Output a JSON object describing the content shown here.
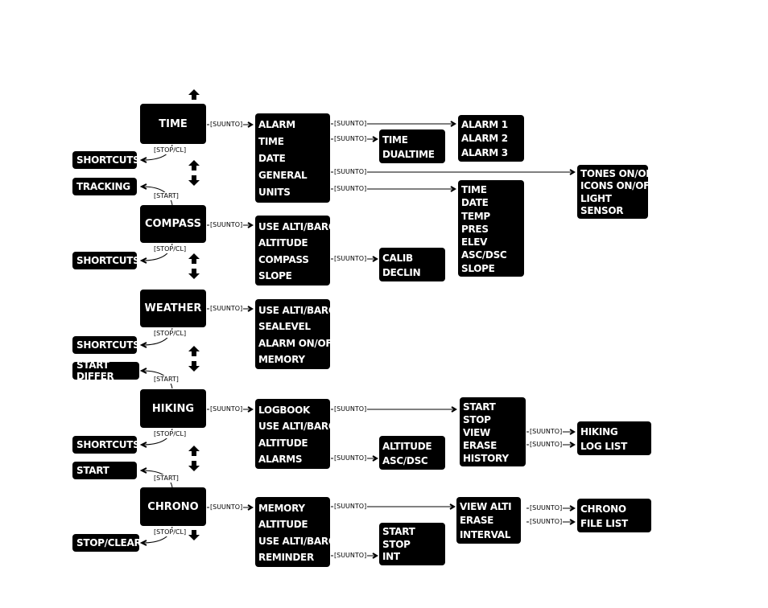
{
  "connector_labels": {
    "suunto": "[SUUNTO]",
    "stop_cl": "[STOP/CL]",
    "start": "[START]"
  },
  "modes": [
    "TIME",
    "COMPASS",
    "WEATHER",
    "HIKING",
    "CHRONO"
  ],
  "left_actions": [
    "SHORTCUTS",
    "TRACKING",
    "SHORTCUTS",
    "SHORTCUTS",
    "START DIFFER",
    "SHORTCUTS",
    "START",
    "STOP/CLEAR"
  ],
  "menus": {
    "time": [
      "ALARM",
      "TIME",
      "DATE",
      "GENERAL",
      "UNITS"
    ],
    "compass": [
      "USE ALTI/BARO",
      "ALTITUDE",
      "COMPASS",
      "SLOPE"
    ],
    "weather": [
      "USE ALTI/BARO",
      "SEALEVEL",
      "ALARM ON/OFF",
      "MEMORY"
    ],
    "hiking": [
      "LOGBOOK",
      "USE ALTI/BARO",
      "ALTITUDE",
      "ALARMS"
    ],
    "chrono": [
      "MEMORY",
      "ALTITUDE",
      "USE ALTI/BARO",
      "REMINDER"
    ]
  },
  "submenus": {
    "alarms": [
      "ALARM 1",
      "ALARM  2",
      "ALARM 3"
    ],
    "time_dual": [
      "TIME",
      "DUALTIME"
    ],
    "general": [
      "TONES ON/OFF",
      "ICONS ON/OFF",
      "LIGHT",
      "SENSOR"
    ],
    "units": [
      "TIME",
      "DATE",
      "TEMP",
      "PRES",
      "ELEV",
      "ASC/DSC",
      "SLOPE"
    ],
    "compass_calib": [
      "CALIB",
      "DECLIN"
    ],
    "hiking_alarms": [
      "ALTITUDE",
      "ASC/DSC"
    ],
    "logbook": [
      "START",
      "STOP",
      "VIEW",
      "ERASE",
      "HISTORY"
    ],
    "hiking_log": [
      "HIKING",
      "LOG LIST"
    ],
    "chrono_memory": [
      "VIEW ALTI",
      "ERASE",
      "INTERVAL"
    ],
    "chrono_file": [
      "CHRONO",
      "FILE LIST"
    ],
    "reminder": [
      "START",
      "STOP",
      "INT"
    ]
  }
}
